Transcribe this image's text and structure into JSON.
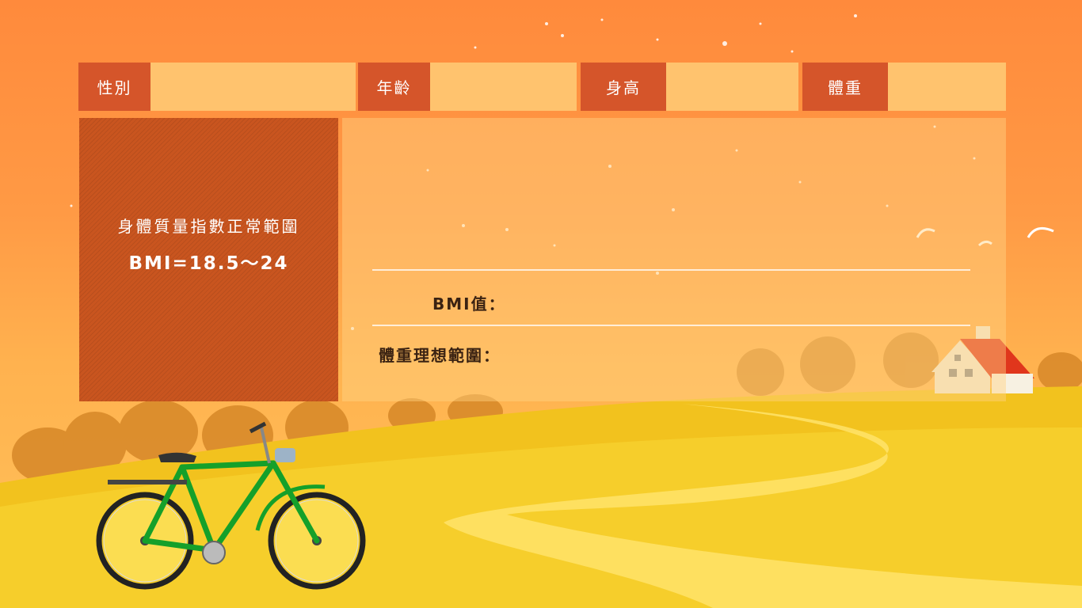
{
  "form": {
    "gender_label": "性別",
    "gender_value": "",
    "age_label": "年齡",
    "age_value": "",
    "height_label": "身高",
    "height_value": "",
    "weight_label": "體重",
    "weight_value": ""
  },
  "info_panel": {
    "title": "身體質量指數正常範圍",
    "range": "BMI=18.5～24"
  },
  "results": {
    "bmi_label": "BMI值：",
    "bmi_value": "",
    "ideal_weight_label": "體重理想範圍：",
    "ideal_weight_value": ""
  },
  "colors": {
    "label_bg": "#d5552a",
    "field_bg": "#ffc36e",
    "panel_bg": "#c9551f"
  }
}
